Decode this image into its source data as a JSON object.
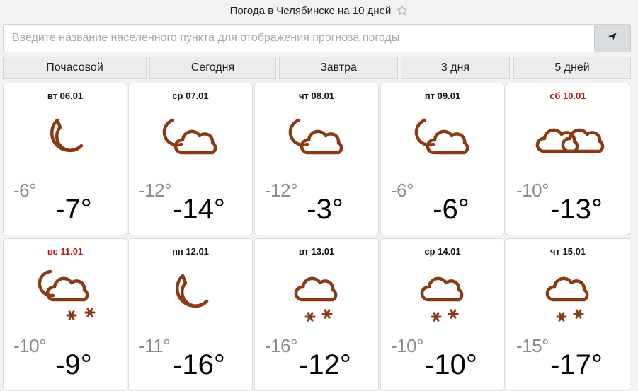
{
  "header": {
    "title": "Погода в Челябинске на 10 дней",
    "favorite_icon": "star-outline-icon"
  },
  "search": {
    "placeholder": "Введите название населенного пункта для отображения прогноза погоды",
    "value": "",
    "locate_icon": "location-arrow-icon"
  },
  "tabs": [
    {
      "label": "Почасовой"
    },
    {
      "label": "Сегодня"
    },
    {
      "label": "Завтра"
    },
    {
      "label": "3 дня"
    },
    {
      "label": "5 дней"
    }
  ],
  "colors": {
    "icon": "#8a3a12",
    "weekend": "#b51c1c",
    "night_temp": "#8c8c8c"
  },
  "days": [
    {
      "date": "вт 06.01",
      "night": "-6°",
      "day": "-7°",
      "icon": "moon-icon",
      "weekend": false
    },
    {
      "date": "ср 07.01",
      "night": "-12°",
      "day": "-14°",
      "icon": "moon-cloud-icon",
      "weekend": false
    },
    {
      "date": "чт 08.01",
      "night": "-12°",
      "day": "-3°",
      "icon": "moon-cloud-icon",
      "weekend": false
    },
    {
      "date": "пт 09.01",
      "night": "-6°",
      "day": "-6°",
      "icon": "moon-cloud-icon",
      "weekend": false
    },
    {
      "date": "сб 10.01",
      "night": "-10°",
      "day": "-13°",
      "icon": "double-cloud-icon",
      "weekend": true
    },
    {
      "date": "вс 11.01",
      "night": "-10°",
      "day": "-9°",
      "icon": "moon-cloud-snow-icon",
      "weekend": true
    },
    {
      "date": "пн 12.01",
      "night": "-11°",
      "day": "-16°",
      "icon": "moon-icon",
      "weekend": false
    },
    {
      "date": "вт 13.01",
      "night": "-16°",
      "day": "-12°",
      "icon": "cloud-snow-icon",
      "weekend": false
    },
    {
      "date": "ср 14.01",
      "night": "-10°",
      "day": "-10°",
      "icon": "cloud-snow-icon",
      "weekend": false
    },
    {
      "date": "чт 15.01",
      "night": "-15°",
      "day": "-17°",
      "icon": "cloud-snow-icon",
      "weekend": false
    }
  ]
}
